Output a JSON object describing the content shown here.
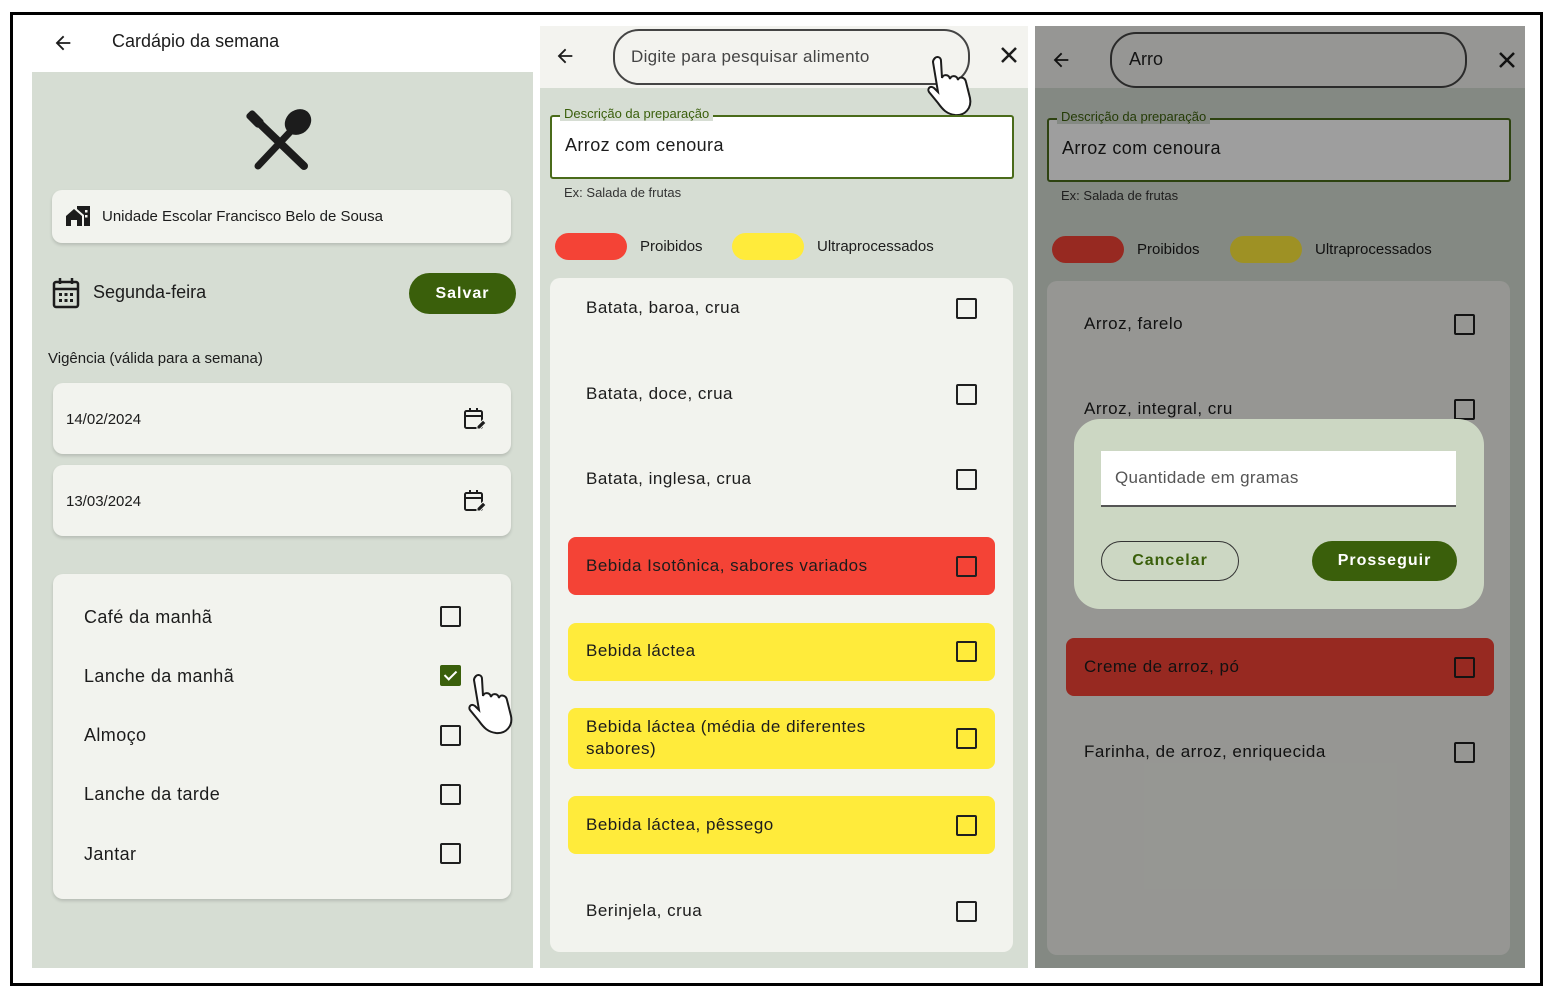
{
  "screen1": {
    "title": "Cardápio da semana",
    "school": "Unidade Escolar Francisco Belo de Sousa",
    "day": "Segunda-feira",
    "save_label": "Salvar",
    "validity_label": "Vigência (válida para a semana)",
    "date_start": "14/02/2024",
    "date_end": "13/03/2024",
    "meals": [
      {
        "label": "Café da manhã",
        "checked": false
      },
      {
        "label": "Lanche da manhã",
        "checked": true
      },
      {
        "label": "Almoço",
        "checked": false
      },
      {
        "label": "Lanche da tarde",
        "checked": false
      },
      {
        "label": "Jantar",
        "checked": false
      }
    ]
  },
  "screen2": {
    "search_placeholder": "Digite para pesquisar alimento",
    "prep_legend": "Descrição da preparação",
    "prep_value": "Arroz com cenoura",
    "prep_hint": "Ex: Salada de frutas",
    "legend_forbidden": "Proibidos",
    "legend_ultra": "Ultraprocessados",
    "items": [
      {
        "label": "Batata, baroa, crua",
        "category": "none"
      },
      {
        "label": "Batata, doce, crua",
        "category": "none"
      },
      {
        "label": "Batata, inglesa, crua",
        "category": "none"
      },
      {
        "label": "Bebida Isotônica, sabores variados",
        "category": "forbidden"
      },
      {
        "label": "Bebida láctea",
        "category": "ultra"
      },
      {
        "label": "Bebida láctea (média de diferentes",
        "label2": "sabores)",
        "category": "ultra"
      },
      {
        "label": "Bebida láctea, pêssego",
        "category": "ultra"
      },
      {
        "label": "Berinjela, crua",
        "category": "none"
      }
    ]
  },
  "screen3": {
    "search_value": "Arro",
    "prep_legend": "Descrição da preparação",
    "prep_value": "Arroz com cenoura",
    "prep_hint": "Ex: Salada de frutas",
    "legend_forbidden": "Proibidos",
    "legend_ultra": "Ultraprocessados",
    "items": [
      {
        "label": "Arroz, farelo",
        "category": "none"
      },
      {
        "label": "Arroz, integral, cru",
        "category": "none"
      },
      {
        "label": "Creme de arroz, pó",
        "category": "forbidden"
      },
      {
        "label": "Farinha, de arroz, enriquecida",
        "category": "none"
      }
    ],
    "dialog": {
      "quantity_placeholder": "Quantidade em gramas",
      "cancel_label": "Cancelar",
      "proceed_label": "Prosseguir"
    }
  },
  "colors": {
    "accent": "#3a5f0b",
    "forbidden": "#f44336",
    "ultra": "#ffeb3b",
    "background": "#d6ddd3"
  }
}
